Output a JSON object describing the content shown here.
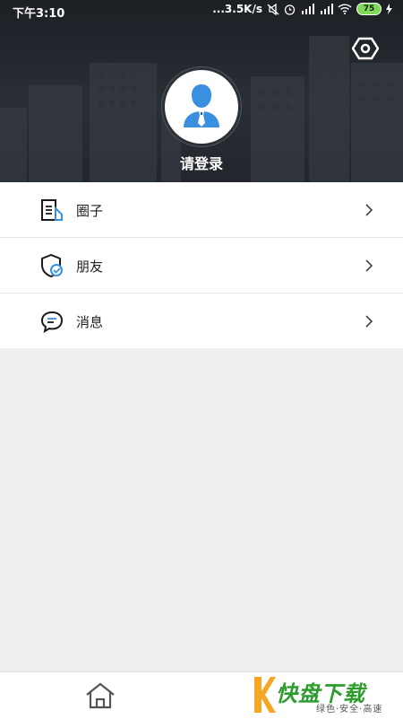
{
  "status_bar": {
    "time": "下午3:10",
    "network_speed": "...3.5K/s",
    "battery": "75",
    "icons": [
      "mute-icon",
      "alarm-icon",
      "signal-hd-icon",
      "signal-hd-icon",
      "wifi-icon",
      "battery-icon",
      "charging-icon"
    ]
  },
  "header": {
    "login_text": "请登录",
    "avatar_icon": "user-avatar-icon",
    "settings_icon": "settings-icon"
  },
  "menu": {
    "items": [
      {
        "label": "圈子",
        "icon": "document-icon"
      },
      {
        "label": "朋友",
        "icon": "shield-check-icon"
      },
      {
        "label": "消息",
        "icon": "chat-bubble-icon"
      }
    ]
  },
  "tabbar": {
    "home_icon": "home-icon"
  },
  "watermark": {
    "logo": "K",
    "title": "快盘下载",
    "subtitle": "绿色·安全·高速"
  },
  "colors": {
    "header_bg": "#23262c",
    "accent_blue": "#3a8fe0",
    "page_bg": "#efefef",
    "brand_green": "#2c9c2e",
    "brand_orange": "#f5a623"
  }
}
